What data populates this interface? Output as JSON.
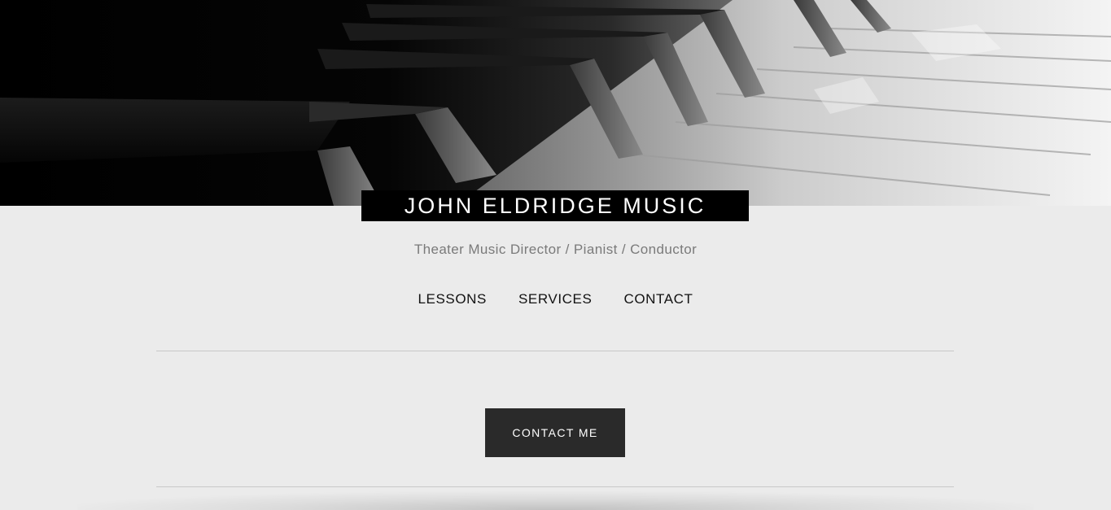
{
  "site": {
    "title": "JOHN ELDRIDGE MUSIC",
    "subtitle": "Theater Music Director / Pianist / Conductor"
  },
  "hero": {
    "image": "piano-keys-photo"
  },
  "nav": {
    "items": [
      {
        "label": "LESSONS"
      },
      {
        "label": "SERVICES"
      },
      {
        "label": "CONTACT"
      }
    ]
  },
  "cta": {
    "label": "CONTACT ME"
  },
  "colors": {
    "background": "#ebebeb",
    "title_box": "#000000",
    "button": "#2a2a2a",
    "subtitle_text": "#7a7a7a"
  }
}
